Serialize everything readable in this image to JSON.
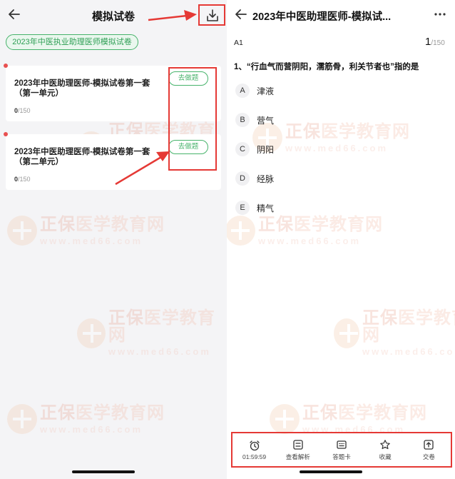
{
  "left": {
    "title": "模拟试卷",
    "category_tag": "2023年中医执业助理医师模拟试卷",
    "cards": [
      {
        "title": "2023年中医助理医师-模拟试卷第一套（第一单元）",
        "done": "0",
        "total": "/150",
        "button": "去做题"
      },
      {
        "title": "2023年中医助理医师-模拟试卷第一套（第二单元）",
        "done": "0",
        "total": "/150",
        "button": "去做题"
      }
    ]
  },
  "right": {
    "title": "2023年中医助理医师-模拟试...",
    "question_type": "A1",
    "current": "1",
    "total": "/150",
    "question": "1、“行血气而营阴阳，濡筋骨，利关节者也”指的是",
    "options": [
      {
        "key": "A",
        "text": "津液"
      },
      {
        "key": "B",
        "text": "营气"
      },
      {
        "key": "C",
        "text": "阴阳"
      },
      {
        "key": "D",
        "text": "经脉"
      },
      {
        "key": "E",
        "text": "精气"
      }
    ],
    "toolbar": {
      "timer": "01:59:59",
      "analysis": "查看解析",
      "answer_card": "答题卡",
      "favorite": "收藏",
      "submit": "交卷"
    }
  },
  "watermark": {
    "brand_cn_a": "正保",
    "brand_cn_b": "医学教育网",
    "url": "www.med66.com"
  },
  "colors": {
    "accent_green": "#47b36b",
    "annotation_red": "#e53935",
    "dot_red": "#e85050"
  }
}
